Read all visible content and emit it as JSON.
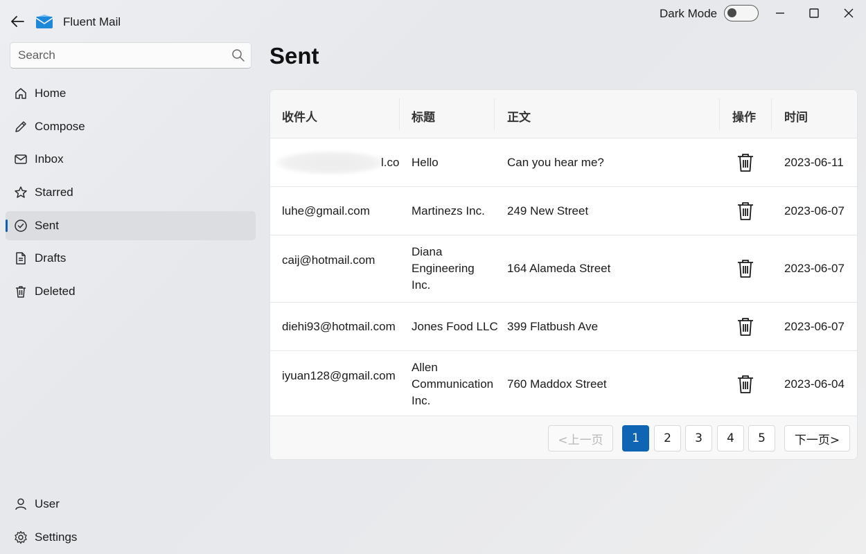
{
  "app": {
    "title": "Fluent Mail"
  },
  "titlebar": {
    "dark_mode_label": "Dark Mode",
    "dark_mode_on": false
  },
  "search": {
    "placeholder": "Search",
    "value": ""
  },
  "sidebar": {
    "items": [
      {
        "label": "Home",
        "icon": "home-icon"
      },
      {
        "label": "Compose",
        "icon": "pencil-icon"
      },
      {
        "label": "Inbox",
        "icon": "envelope-icon"
      },
      {
        "label": "Starred",
        "icon": "star-icon"
      },
      {
        "label": "Sent",
        "icon": "check-circle-icon",
        "active": true
      },
      {
        "label": "Drafts",
        "icon": "document-icon"
      },
      {
        "label": "Deleted",
        "icon": "trash-icon"
      }
    ],
    "footer": [
      {
        "label": "User",
        "icon": "person-icon"
      },
      {
        "label": "Settings",
        "icon": "gear-icon"
      }
    ]
  },
  "main": {
    "title": "Sent",
    "table": {
      "headers": {
        "recipient": "收件人",
        "subject": "标题",
        "body": "正文",
        "action": "操作",
        "time": "时间"
      },
      "rows": [
        {
          "recipient": "l.com",
          "subject": "Hello",
          "body": "Can you hear me?",
          "time": "2023-06-11"
        },
        {
          "recipient": "luhe@gmail.com",
          "subject": "Martinezs Inc.",
          "body": "249 New Street",
          "time": "2023-06-07"
        },
        {
          "recipient": "caij@hotmail.com",
          "subject": "Diana Engineering Inc.",
          "body": "164 Alameda Street",
          "time": "2023-06-07"
        },
        {
          "recipient": "diehi93@hotmail.com",
          "subject": "Jones Food LLC",
          "body": "399 Flatbush Ave",
          "time": "2023-06-07"
        },
        {
          "recipient": "iyuan128@gmail.com",
          "subject": "Allen Communication Inc.",
          "body": "760 Maddox Street",
          "time": "2023-06-04"
        }
      ]
    },
    "pagination": {
      "prev": "<上一页",
      "next": "下一页>",
      "pages": [
        "1",
        "2",
        "3",
        "4",
        "5"
      ],
      "current": "1"
    }
  },
  "colors": {
    "accent": "#0f64b4",
    "active_nav_bg": "#dcdde0"
  }
}
